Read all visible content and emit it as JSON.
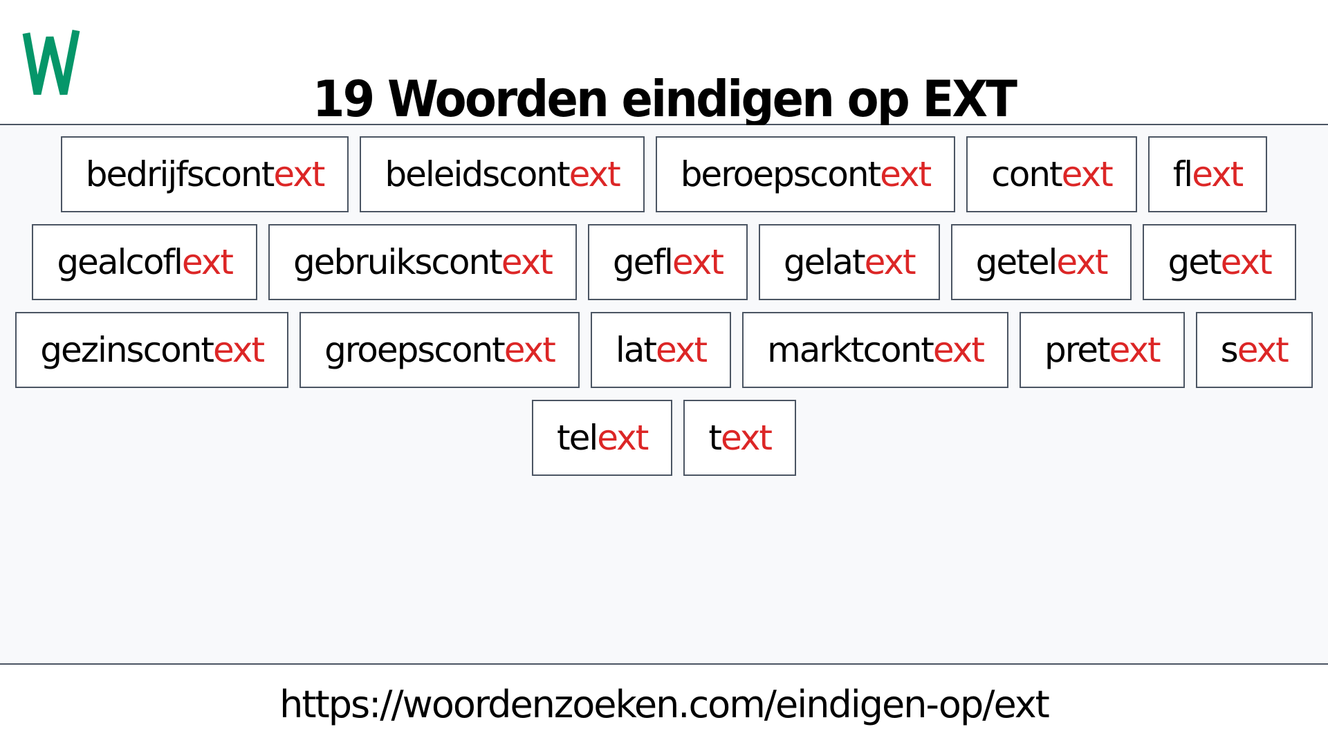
{
  "header": {
    "logo_letter": "W",
    "logo_color": "#059669",
    "title": "19 Woorden eindigen op EXT"
  },
  "colors": {
    "suffix": "#dc2626",
    "text": "#000000",
    "border": "#4b5563",
    "content_background": "#f8f9fb"
  },
  "words": {
    "suffix": "ext",
    "rows": [
      [
        {
          "prefix": "bedrijfscont",
          "suffix": "ext"
        },
        {
          "prefix": "beleidscont",
          "suffix": "ext"
        },
        {
          "prefix": "beroepscont",
          "suffix": "ext"
        },
        {
          "prefix": "cont",
          "suffix": "ext"
        },
        {
          "prefix": "fl",
          "suffix": "ext"
        }
      ],
      [
        {
          "prefix": "gealcofl",
          "suffix": "ext"
        },
        {
          "prefix": "gebruikscont",
          "suffix": "ext"
        },
        {
          "prefix": "gefl",
          "suffix": "ext"
        },
        {
          "prefix": "gelat",
          "suffix": "ext"
        },
        {
          "prefix": "getel",
          "suffix": "ext"
        },
        {
          "prefix": "get",
          "suffix": "ext"
        }
      ],
      [
        {
          "prefix": "gezinscont",
          "suffix": "ext"
        },
        {
          "prefix": "groepscont",
          "suffix": "ext"
        },
        {
          "prefix": "lat",
          "suffix": "ext"
        },
        {
          "prefix": "marktcont",
          "suffix": "ext"
        },
        {
          "prefix": "pret",
          "suffix": "ext"
        },
        {
          "prefix": "s",
          "suffix": "ext"
        }
      ],
      [
        {
          "prefix": "tel",
          "suffix": "ext"
        },
        {
          "prefix": "t",
          "suffix": "ext"
        }
      ]
    ]
  },
  "footer": {
    "url": "https://woordenzoeken.com/eindigen-op/ext"
  }
}
